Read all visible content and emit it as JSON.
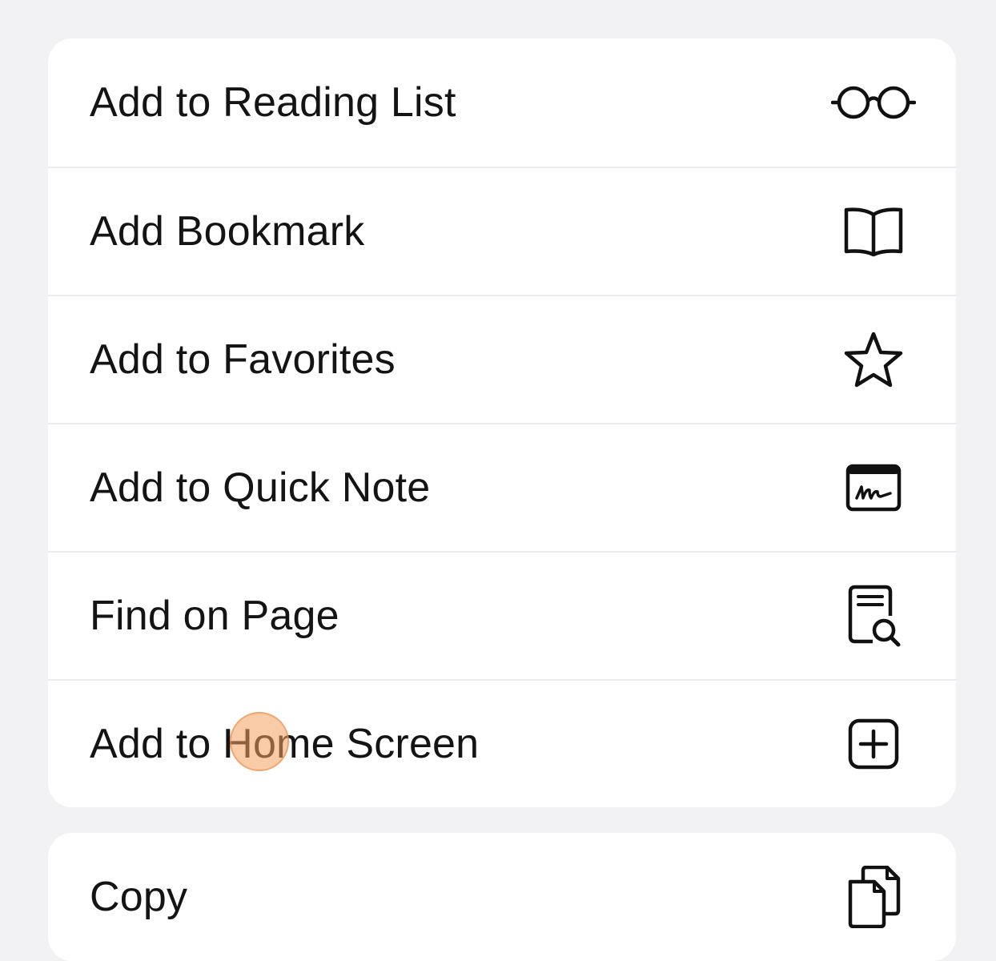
{
  "menu": {
    "primary_items": [
      {
        "label": "Add to Reading List",
        "icon": "glasses-icon"
      },
      {
        "label": "Add Bookmark",
        "icon": "book-icon"
      },
      {
        "label": "Add to Favorites",
        "icon": "star-icon"
      },
      {
        "label": "Add to Quick Note",
        "icon": "quick-note-icon"
      },
      {
        "label": "Find on Page",
        "icon": "doc-search-icon"
      },
      {
        "label": "Add to Home Screen",
        "icon": "plus-square-icon"
      }
    ],
    "secondary_items": [
      {
        "label": "Copy",
        "icon": "copy-icon"
      }
    ]
  },
  "touch_indicator": {
    "color": "#f5a05f"
  }
}
